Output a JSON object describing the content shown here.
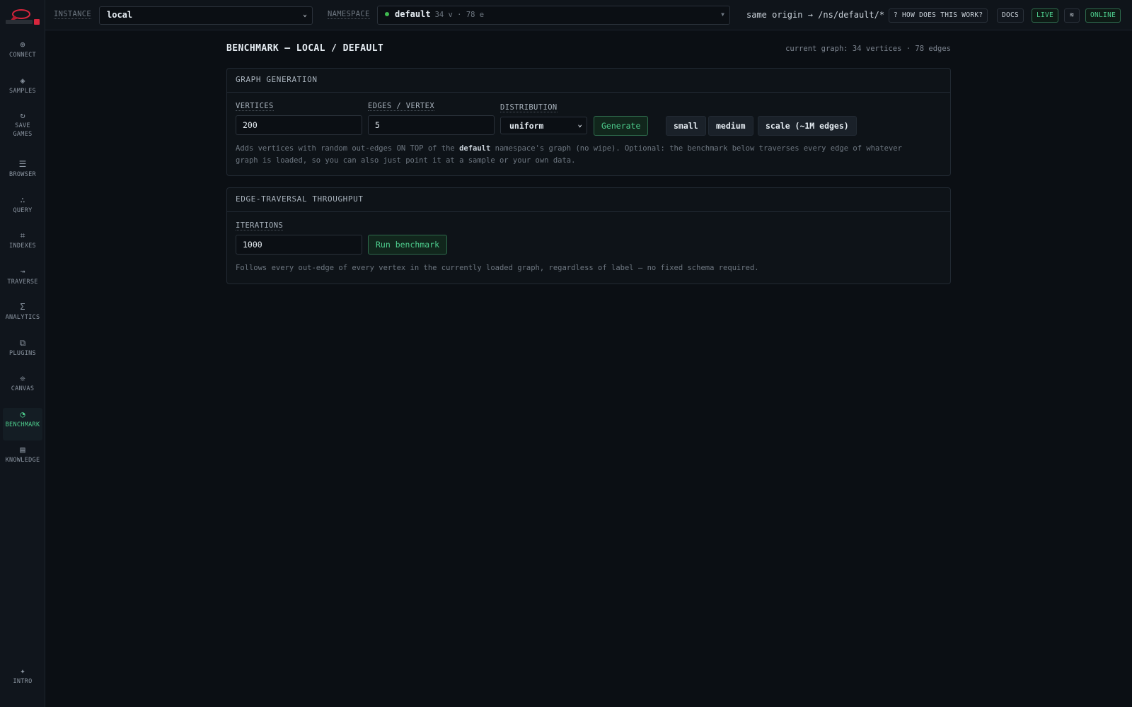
{
  "sidebar": {
    "items": [
      {
        "label": "CONNECT",
        "icon": "⊕"
      },
      {
        "label": "SAMPLES",
        "icon": "◈"
      },
      {
        "label": "SAVE\nGAMES",
        "icon": "↻"
      },
      {
        "label": "BROWSER",
        "icon": "☰"
      },
      {
        "label": "QUERY",
        "icon": "∴"
      },
      {
        "label": "INDEXES",
        "icon": "⌗"
      },
      {
        "label": "TRAVERSE",
        "icon": "↝"
      },
      {
        "label": "ANALYTICS",
        "icon": "Σ"
      },
      {
        "label": "PLUGINS",
        "icon": "⧉"
      },
      {
        "label": "CANVAS",
        "icon": "❊"
      },
      {
        "label": "BENCHMARK",
        "icon": "◔"
      },
      {
        "label": "KNOWLEDGE",
        "icon": "▤"
      }
    ],
    "active": "BENCHMARK",
    "footer": {
      "label": "INTRO",
      "icon": "✦"
    }
  },
  "topbar": {
    "instance_label": "INSTANCE",
    "instance_value": "local",
    "namespace_label": "NAMESPACE",
    "namespace_value": "default",
    "namespace_meta": "34 v · 78 e",
    "origin": "same origin → /ns/default/*",
    "help_button": "? HOW DOES THIS WORK?",
    "docs_button": "DOCS",
    "live_button": "LIVE",
    "theme_icon": "≋",
    "status": "ONLINE"
  },
  "page": {
    "title_prefix": "BENCHMARK",
    "title_sep": " — ",
    "title_instance": "LOCAL",
    "title_slash": " / ",
    "title_namespace": "DEFAULT",
    "graph_summary": "current graph: 34 vertices · 78 edges"
  },
  "generation": {
    "heading": "GRAPH GENERATION",
    "vertices_label": "VERTICES",
    "vertices_value": "200",
    "edges_label": "EDGES / VERTEX",
    "edges_value": "5",
    "distribution_label": "DISTRIBUTION",
    "distribution_value": "uniform",
    "generate_button": "Generate",
    "presets": [
      "small",
      "medium",
      "scale (~1M edges)"
    ],
    "help_before": "Adds vertices with random out-edges ON TOP of the ",
    "help_bold": "default",
    "help_after": " namespace's graph (no wipe). Optional: the benchmark below traverses every edge of whatever",
    "help_line2": "graph is loaded, so you can also just point it at a sample or your own data."
  },
  "throughput": {
    "heading": "EDGE-TRAVERSAL THROUGHPUT",
    "iterations_label": "ITERATIONS",
    "iterations_value": "1000",
    "run_button": "Run benchmark",
    "help": "Follows every out-edge of every vertex in the currently loaded graph, regardless of label — no fixed schema required."
  },
  "colors": {
    "accent": "#4ecf8e",
    "background": "#0b0f14",
    "brand_red": "#d7263d"
  }
}
